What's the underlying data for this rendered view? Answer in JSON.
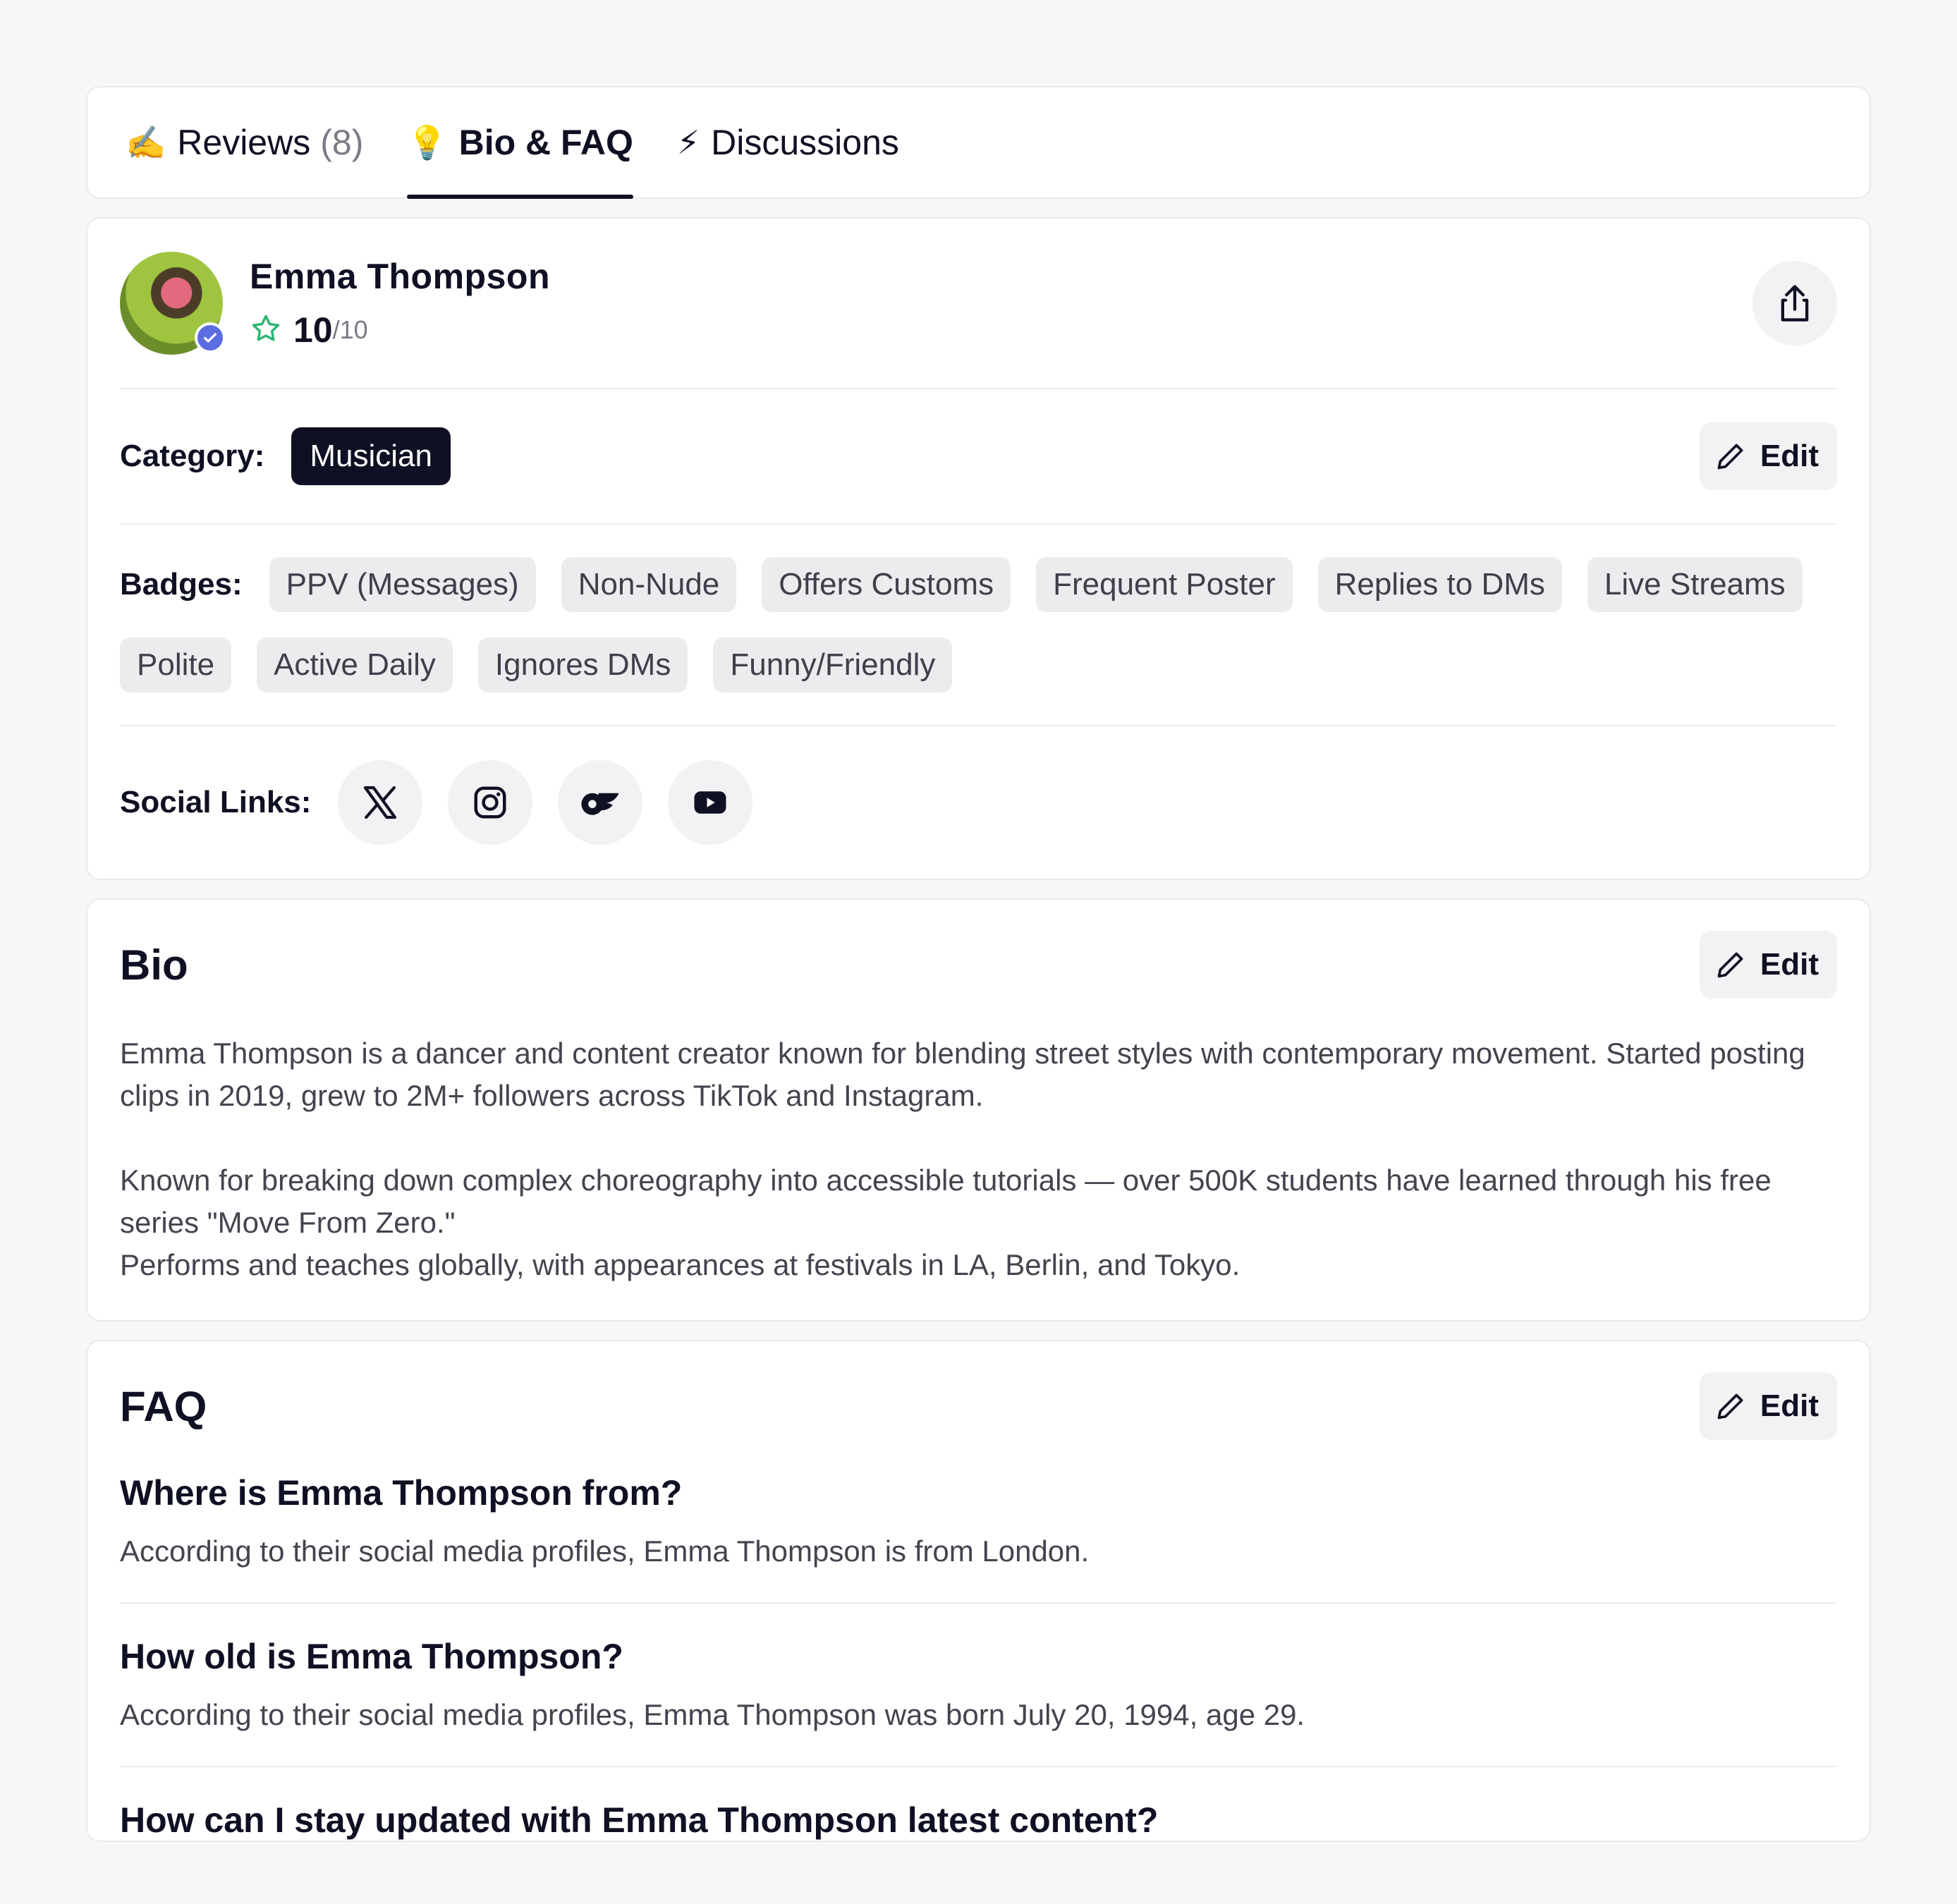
{
  "tabs": [
    {
      "emoji": "✍️",
      "label": "Reviews",
      "count": "(8)",
      "active": false
    },
    {
      "emoji": "💡",
      "label": "Bio & FAQ",
      "count": "",
      "active": true
    },
    {
      "emoji": "⚡",
      "label": "Discussions",
      "count": "",
      "active": false
    }
  ],
  "profile": {
    "name": "Emma Thompson",
    "score": "10",
    "out_of": "/10",
    "category_label": "Category:",
    "category": "Musician",
    "edit_label": "Edit",
    "badges_label": "Badges:",
    "badges": [
      "PPV (Messages)",
      "Non-Nude",
      "Offers Customs",
      "Frequent Poster",
      "Replies to DMs",
      "Live Streams",
      "Polite",
      "Active Daily",
      "Ignores DMs",
      "Funny/Friendly"
    ],
    "social_label": "Social Links:",
    "social_icons": [
      "x-icon",
      "instagram-icon",
      "onlyfans-icon",
      "youtube-icon"
    ]
  },
  "bio": {
    "title": "Bio",
    "edit_label": "Edit",
    "text": "Emma Thompson is a dancer and content creator known for blending street styles with contemporary movement. Started posting clips in 2019, grew to 2M+ followers across TikTok and Instagram.\n\nKnown for breaking down complex choreography into accessible tutorials — over 500K students have learned through his free series \"Move From Zero.\"\nPerforms and teaches globally, with appearances at festivals in LA, Berlin, and Tokyo."
  },
  "faq": {
    "title": "FAQ",
    "edit_label": "Edit",
    "items": [
      {
        "q": "Where is Emma Thompson from?",
        "a": "According to their social media profiles, Emma Thompson is from London."
      },
      {
        "q": "How old is Emma Thompson?",
        "a": "According to their social media profiles, Emma Thompson was born July 20, 1994, age 29."
      },
      {
        "q": "How can I stay updated with Emma Thompson latest content?",
        "a": ""
      }
    ]
  },
  "colors": {
    "accent_dark": "#0f1023",
    "star": "#2bb673",
    "verified": "#5b6de0"
  }
}
